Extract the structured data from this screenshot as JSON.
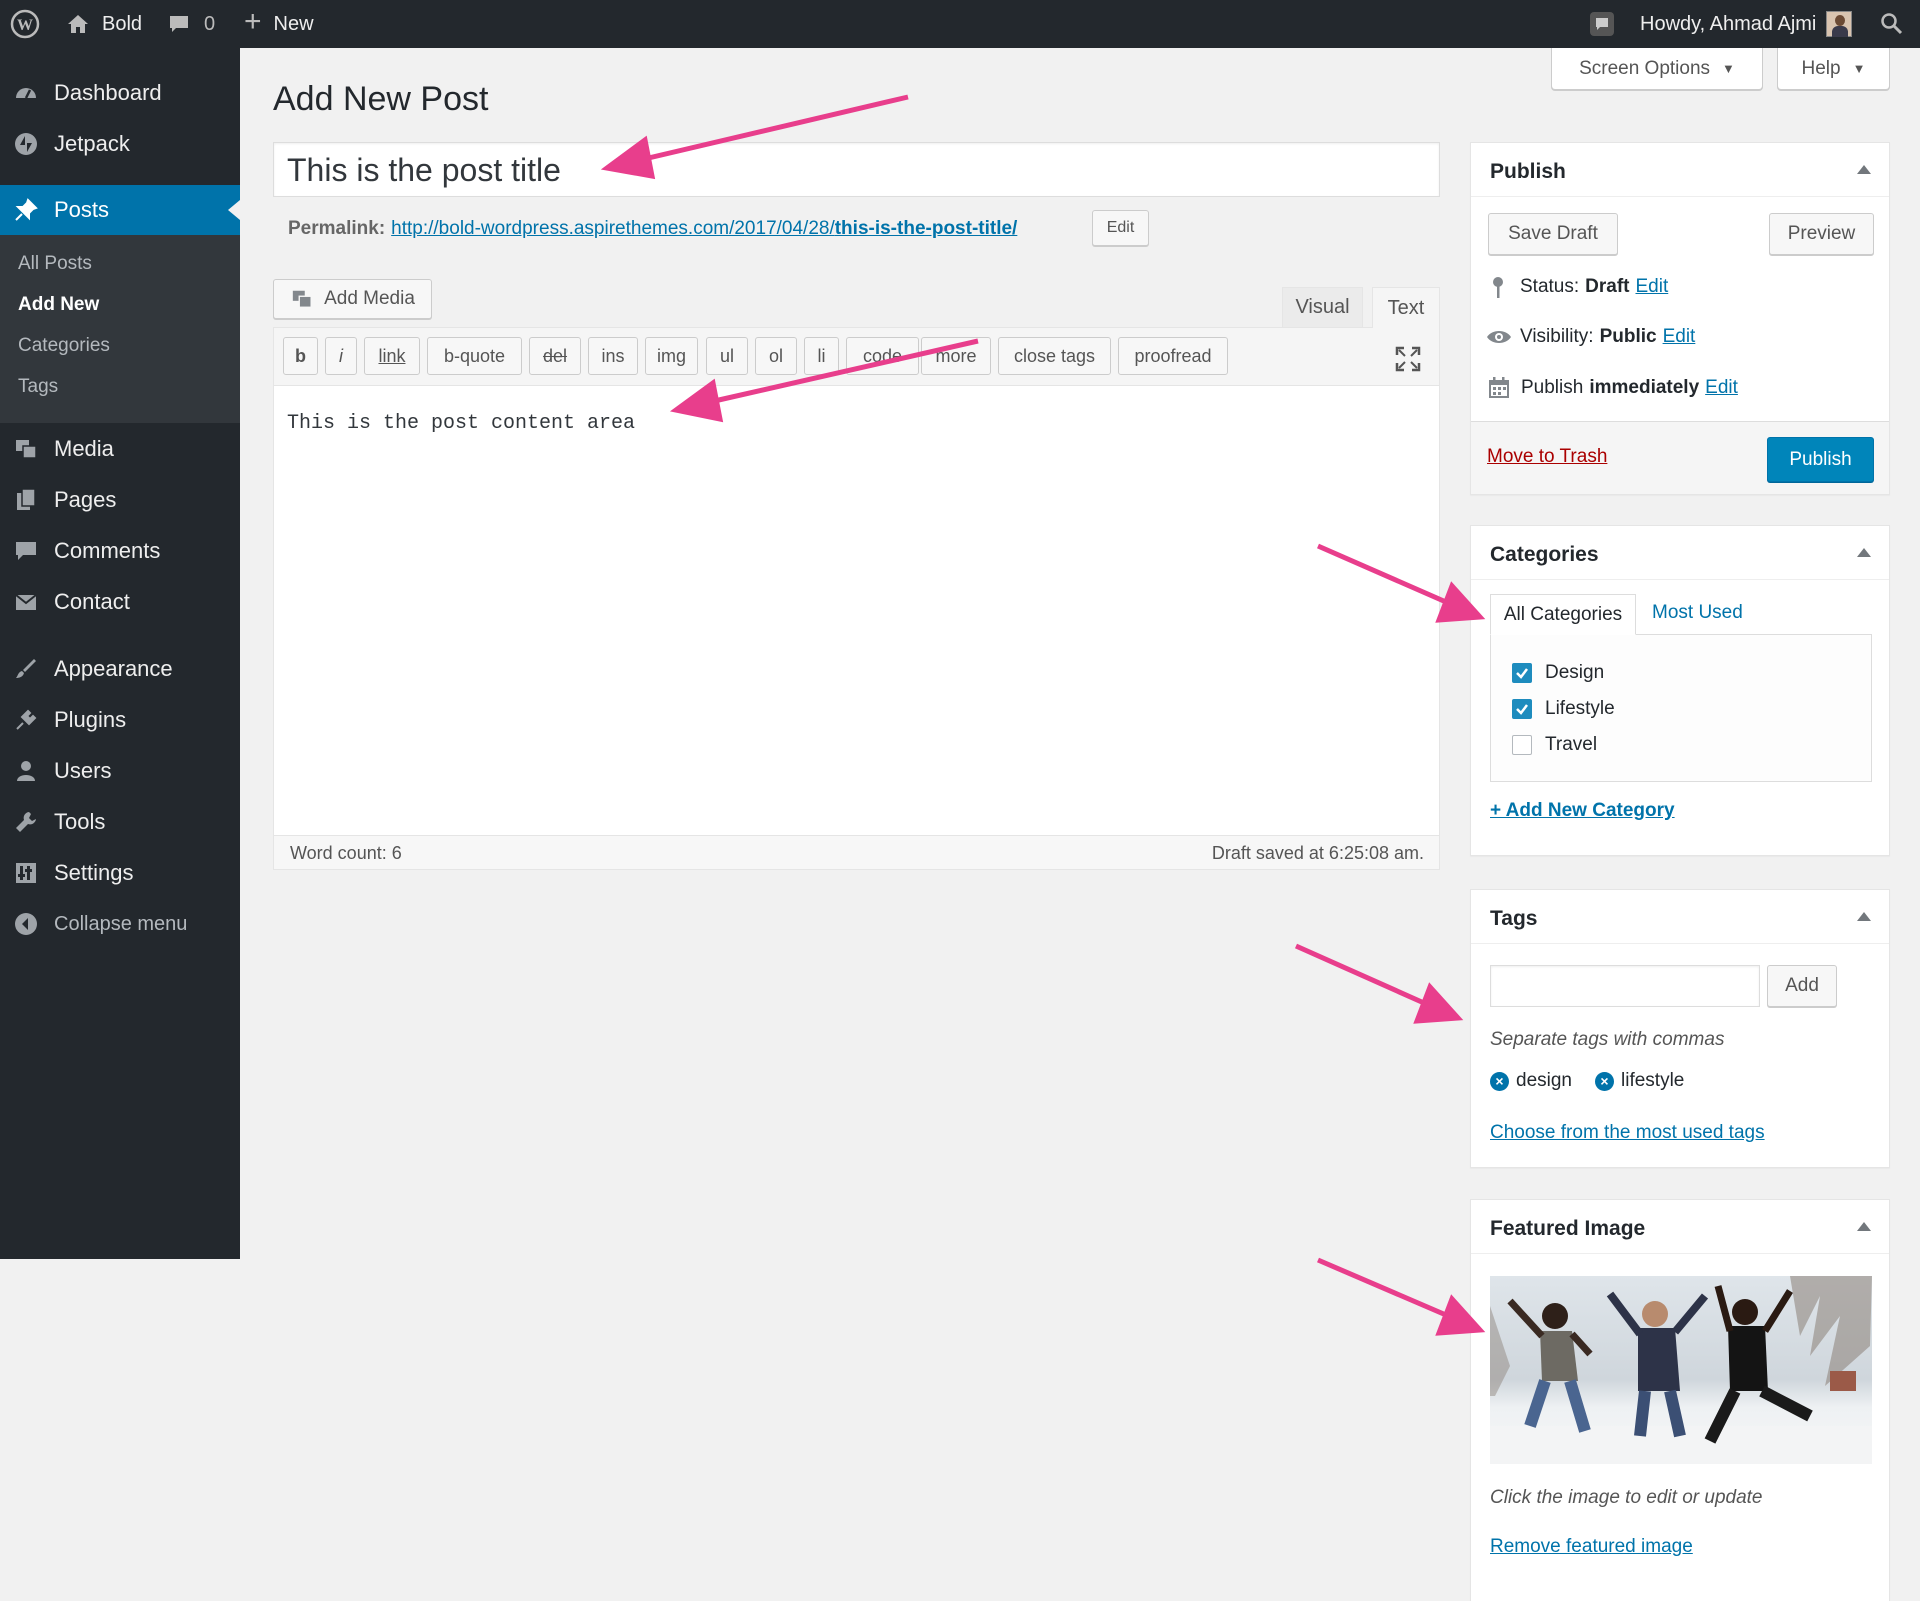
{
  "admin_bar": {
    "site_name": "Bold",
    "comments_count": "0",
    "new_label": "New",
    "greeting": "Howdy, Ahmad Ajmi"
  },
  "sidebar": {
    "items": [
      {
        "label": "Dashboard",
        "icon": "dashboard-icon"
      },
      {
        "label": "Jetpack",
        "icon": "jetpack-icon"
      },
      {
        "label": "Posts",
        "icon": "pin-icon"
      },
      {
        "label": "Media",
        "icon": "media-icon"
      },
      {
        "label": "Pages",
        "icon": "pages-icon"
      },
      {
        "label": "Comments",
        "icon": "comment-icon"
      },
      {
        "label": "Contact",
        "icon": "envelope-icon"
      },
      {
        "label": "Appearance",
        "icon": "brush-icon"
      },
      {
        "label": "Plugins",
        "icon": "plug-icon"
      },
      {
        "label": "Users",
        "icon": "user-icon"
      },
      {
        "label": "Tools",
        "icon": "wrench-icon"
      },
      {
        "label": "Settings",
        "icon": "settings-icon"
      },
      {
        "label": "Collapse menu",
        "icon": "collapse-icon"
      }
    ],
    "posts_submenu": [
      "All Posts",
      "Add New",
      "Categories",
      "Tags"
    ]
  },
  "screen_meta": {
    "screen_options": "Screen Options",
    "help": "Help"
  },
  "page_title": "Add New Post",
  "post": {
    "title": "This is the post title",
    "permalink_label": "Permalink:",
    "permalink_base": "http://bold-wordpress.aspirethemes.com/2017/04/28/",
    "permalink_slug": "this-is-the-post-title/",
    "permalink_edit": "Edit",
    "content": "This is the post content area"
  },
  "editor": {
    "add_media": "Add Media",
    "tab_visual": "Visual",
    "tab_text": "Text",
    "quicktags": [
      "b",
      "i",
      "link",
      "b-quote",
      "del",
      "ins",
      "img",
      "ul",
      "ol",
      "li",
      "code",
      "more",
      "close tags",
      "proofread"
    ],
    "word_count": "Word count: 6",
    "draft_saved": "Draft saved at 6:25:08 am."
  },
  "publish_box": {
    "title": "Publish",
    "save_draft": "Save Draft",
    "preview": "Preview",
    "status_label": "Status:",
    "status_value": "Draft",
    "visibility_label": "Visibility:",
    "visibility_value": "Public",
    "publish_label": "Publish",
    "publish_value": "immediately",
    "edit": "Edit",
    "move_to_trash": "Move to Trash",
    "publish_button": "Publish"
  },
  "categories_box": {
    "title": "Categories",
    "tab_all": "All Categories",
    "tab_most_used": "Most Used",
    "items": [
      {
        "label": "Design",
        "checked": true
      },
      {
        "label": "Lifestyle",
        "checked": true
      },
      {
        "label": "Travel",
        "checked": false
      }
    ],
    "add_new": "+ Add New Category"
  },
  "tags_box": {
    "title": "Tags",
    "input_value": "",
    "add_button": "Add",
    "hint": "Separate tags with commas",
    "tags": [
      "design",
      "lifestyle"
    ],
    "choose_link": "Choose from the most used tags"
  },
  "featured_image_box": {
    "title": "Featured Image",
    "hint": "Click the image to edit or update",
    "remove_link": "Remove featured image"
  },
  "colors": {
    "admin_dark": "#23282d",
    "accent": "#0073aa",
    "annotation_arrow": "#e83e8c"
  }
}
